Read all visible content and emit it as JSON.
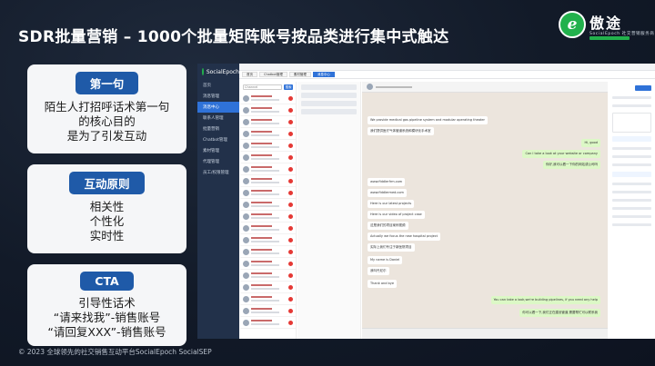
{
  "title": "SDR批量营销 – 1000个批量矩阵账号按品类进行集中式触达",
  "logo": {
    "mark": "e",
    "name": "傲途",
    "subtitle": "SocialEpoch 社交营销服务商"
  },
  "cards": [
    {
      "badge": "第一句",
      "lines": [
        "陌生人打招呼话术第一句",
        "的核心目的",
        "是为了引发互动"
      ]
    },
    {
      "badge": "互动原则",
      "lines": [
        "相关性",
        "个性化",
        "实时性"
      ]
    },
    {
      "badge": "CTA",
      "lines": [
        "引导性话术",
        "“请来找我”-销售账号",
        "“请回复XXX”-销售账号"
      ]
    }
  ],
  "footer": "© 2023 全球领先的社交销售互动平台SocialEpoch SocialSEP",
  "app": {
    "brand": "SocialEpoch",
    "sidebar": [
      "首页",
      "消息管理",
      "消息中心",
      "联系人管理",
      "批量营销",
      "Chatbot管理",
      "素材管理",
      "代理管理",
      "员工/权限管理"
    ],
    "tabs": [
      "首页",
      "Chatbot管理",
      "素材管理",
      "消息中心"
    ],
    "filter_placeholder": "Channel",
    "filter_button": "搜索",
    "messages": [
      {
        "dir": "in",
        "text": "We provide medical gas pipeline system and modular operating theater"
      },
      {
        "dir": "in",
        "text": "我们提供医疗气体管道系统和模块化手术室"
      },
      {
        "dir": "out",
        "text": "Hi, good"
      },
      {
        "dir": "out",
        "text": "Can I take a look at your website or company"
      },
      {
        "dir": "out",
        "text": "你好,我可以看一下你的网站或公司吗"
      },
      {
        "dir": "in",
        "text": "www.fiddlerfrm.com"
      },
      {
        "dir": "in",
        "text": "www.fiddlermed.com"
      },
      {
        "dir": "in",
        "text": "Here is our latest projects"
      },
      {
        "dir": "in",
        "text": "Here is our video of project case"
      },
      {
        "dir": "in",
        "text": "这是我们的项目案例视频"
      },
      {
        "dir": "in",
        "text": "Actually we focus the new hospital project"
      },
      {
        "dir": "in",
        "text": "实际上我们专注于新医院项目"
      },
      {
        "dir": "in",
        "text": "My name is Daniel"
      },
      {
        "dir": "in",
        "text": "我叫丹尼尔"
      },
      {
        "dir": "in",
        "text": "Thank and bye"
      },
      {
        "dir": "out",
        "text": "You can take a look,we're building pipelines, if you need any help"
      },
      {
        "dir": "out",
        "text": "你可以看一下,我们正在建设管道,需要帮忙可以联系我"
      }
    ]
  }
}
